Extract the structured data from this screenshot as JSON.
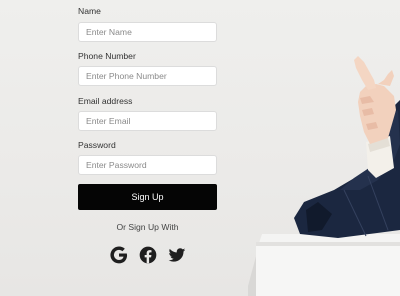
{
  "signup_form": {
    "fields": [
      {
        "label": "Name",
        "placeholder": "Enter Name"
      },
      {
        "label": "Phone Number",
        "placeholder": "Enter Phone Number"
      },
      {
        "label": "Email address",
        "placeholder": "Enter Email"
      },
      {
        "label": "Password",
        "placeholder": "Enter Password"
      }
    ],
    "submit_label": "Sign Up",
    "alt_signup_text": "Or Sign Up With",
    "social_providers": [
      {
        "name": "google",
        "icon": "google-icon"
      },
      {
        "name": "facebook",
        "icon": "facebook-icon"
      },
      {
        "name": "twitter",
        "icon": "twitter-icon"
      }
    ]
  },
  "colors": {
    "background": "#ebeae8",
    "button_background": "#050505",
    "button_text": "#ffffff",
    "input_border": "#dcdcdc",
    "icon_color": "#1f1f1f"
  }
}
